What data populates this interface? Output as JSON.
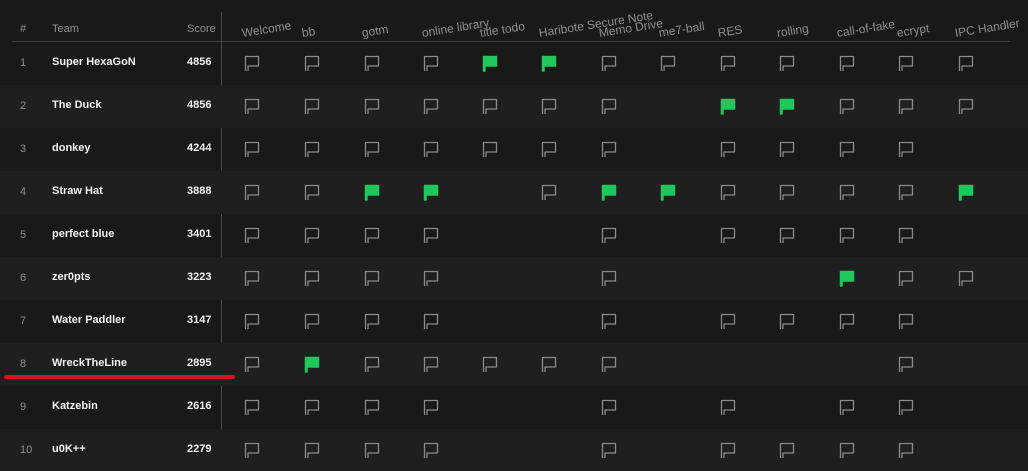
{
  "header": {
    "rank_label": "#",
    "team_label": "Team",
    "score_label": "Score"
  },
  "challenges": [
    "Welcome",
    "bb",
    "gotm",
    "online library",
    "title todo",
    "Haribote Secure Note",
    "Memo Drive",
    "me7-ball",
    "RES",
    "rolling",
    "call-of-fake",
    "ecrypt",
    "IPC Handler"
  ],
  "legend": {
    "solved": "green flag",
    "unsolved": "outlined flag",
    "blank": "no flag"
  },
  "colors": {
    "background": "#191919",
    "alt_row": "#1f1f1f",
    "solved_flag": "#1ec85a",
    "unsolved_flag": "#8a8a8a",
    "highlight_underline": "#c9191e"
  },
  "highlighted_team": "WreckTheLine",
  "rows": [
    {
      "rank": "1",
      "team": "Super HexaGoN",
      "score": "4856",
      "status": [
        "o",
        "o",
        "o",
        "o",
        "s",
        "s",
        "o",
        "o",
        "o",
        "o",
        "o",
        "o",
        "o"
      ]
    },
    {
      "rank": "2",
      "team": "The Duck",
      "score": "4856",
      "status": [
        "o",
        "o",
        "o",
        "o",
        "o",
        "o",
        "o",
        "-",
        "s",
        "s",
        "o",
        "o",
        "o"
      ]
    },
    {
      "rank": "3",
      "team": "donkey",
      "score": "4244",
      "status": [
        "o",
        "o",
        "o",
        "o",
        "o",
        "o",
        "o",
        "-",
        "o",
        "o",
        "o",
        "o",
        "-"
      ]
    },
    {
      "rank": "4",
      "team": "Straw Hat",
      "score": "3888",
      "status": [
        "o",
        "o",
        "s",
        "s",
        "-",
        "o",
        "s",
        "s",
        "o",
        "o",
        "o",
        "o",
        "s"
      ]
    },
    {
      "rank": "5",
      "team": "perfect blue",
      "score": "3401",
      "status": [
        "o",
        "o",
        "o",
        "o",
        "-",
        "-",
        "o",
        "-",
        "o",
        "o",
        "o",
        "o",
        "-"
      ]
    },
    {
      "rank": "6",
      "team": "zer0pts",
      "score": "3223",
      "status": [
        "o",
        "o",
        "o",
        "o",
        "-",
        "-",
        "o",
        "-",
        "-",
        "-",
        "s",
        "o",
        "o"
      ]
    },
    {
      "rank": "7",
      "team": "Water Paddler",
      "score": "3147",
      "status": [
        "o",
        "o",
        "o",
        "o",
        "-",
        "-",
        "o",
        "-",
        "o",
        "o",
        "o",
        "o",
        "-"
      ]
    },
    {
      "rank": "8",
      "team": "WreckTheLine",
      "score": "2895",
      "status": [
        "o",
        "s",
        "o",
        "o",
        "o",
        "o",
        "o",
        "-",
        "-",
        "-",
        "-",
        "o",
        "-"
      ]
    },
    {
      "rank": "9",
      "team": "Katzebin",
      "score": "2616",
      "status": [
        "o",
        "o",
        "o",
        "o",
        "-",
        "-",
        "o",
        "-",
        "o",
        "-",
        "o",
        "o",
        "-"
      ]
    },
    {
      "rank": "10",
      "team": "u0K++",
      "score": "2279",
      "status": [
        "o",
        "o",
        "o",
        "o",
        "-",
        "-",
        "o",
        "-",
        "o",
        "o",
        "o",
        "o",
        "-"
      ]
    }
  ]
}
